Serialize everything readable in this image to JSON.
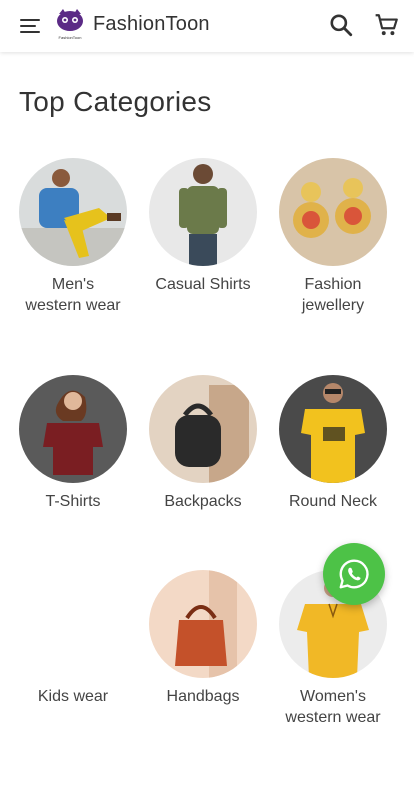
{
  "appbar": {
    "brand_name": "FashionToon",
    "logo_text": "FashionToon",
    "menu_icon": "hamburger-menu-icon",
    "search_icon": "search-icon",
    "cart_icon": "shopping-cart-icon"
  },
  "section_title": "Top Categories",
  "categories": [
    {
      "label": "Men's\nwestern wear",
      "icon": "mens-western-wear-photo"
    },
    {
      "label": "Casual Shirts",
      "icon": "casual-shirts-photo"
    },
    {
      "label": "Fashion\njewellery",
      "icon": "fashion-jewellery-photo"
    },
    {
      "label": "T-Shirts",
      "icon": "t-shirts-photo"
    },
    {
      "label": "Backpacks",
      "icon": "backpacks-photo"
    },
    {
      "label": "Round Neck",
      "icon": "round-neck-photo"
    },
    {
      "label": "Kids wear",
      "icon": ""
    },
    {
      "label": "Handbags",
      "icon": "handbags-photo"
    },
    {
      "label": "Women's\nwestern wear",
      "icon": "womens-western-wear-photo"
    }
  ],
  "fab": {
    "icon": "whatsapp-icon",
    "color": "#4dc247"
  }
}
